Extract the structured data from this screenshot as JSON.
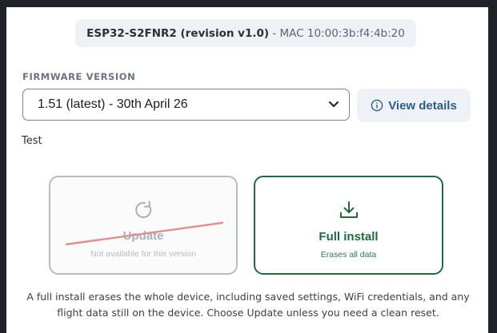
{
  "device": {
    "model": "ESP32-S2FNR2 (revision v1.0)",
    "separator": " - ",
    "mac": "MAC 10:00:3b:f4:4b:20"
  },
  "firmware": {
    "section_label": "FIRMWARE VERSION",
    "selected_version": "1.51 (latest) - 30th April 26",
    "view_details_label": "View details"
  },
  "note": "Test",
  "options": {
    "update": {
      "title": "Update",
      "subtitle": "Not available for this version",
      "icon": "refresh-icon",
      "available": false
    },
    "full_install": {
      "title": "Full install",
      "subtitle": "Erases all data",
      "icon": "download-icon"
    }
  },
  "warning": "A full install erases the whole device, including saved settings, WiFi credentials, and any flight data still on the device. Choose Update unless you need a clean reset.",
  "colors": {
    "accent_green": "#1e6b3c",
    "disabled_border": "#a8b2bd",
    "strike_red": "#e07a7a",
    "link_blue": "#2f5d8a"
  }
}
